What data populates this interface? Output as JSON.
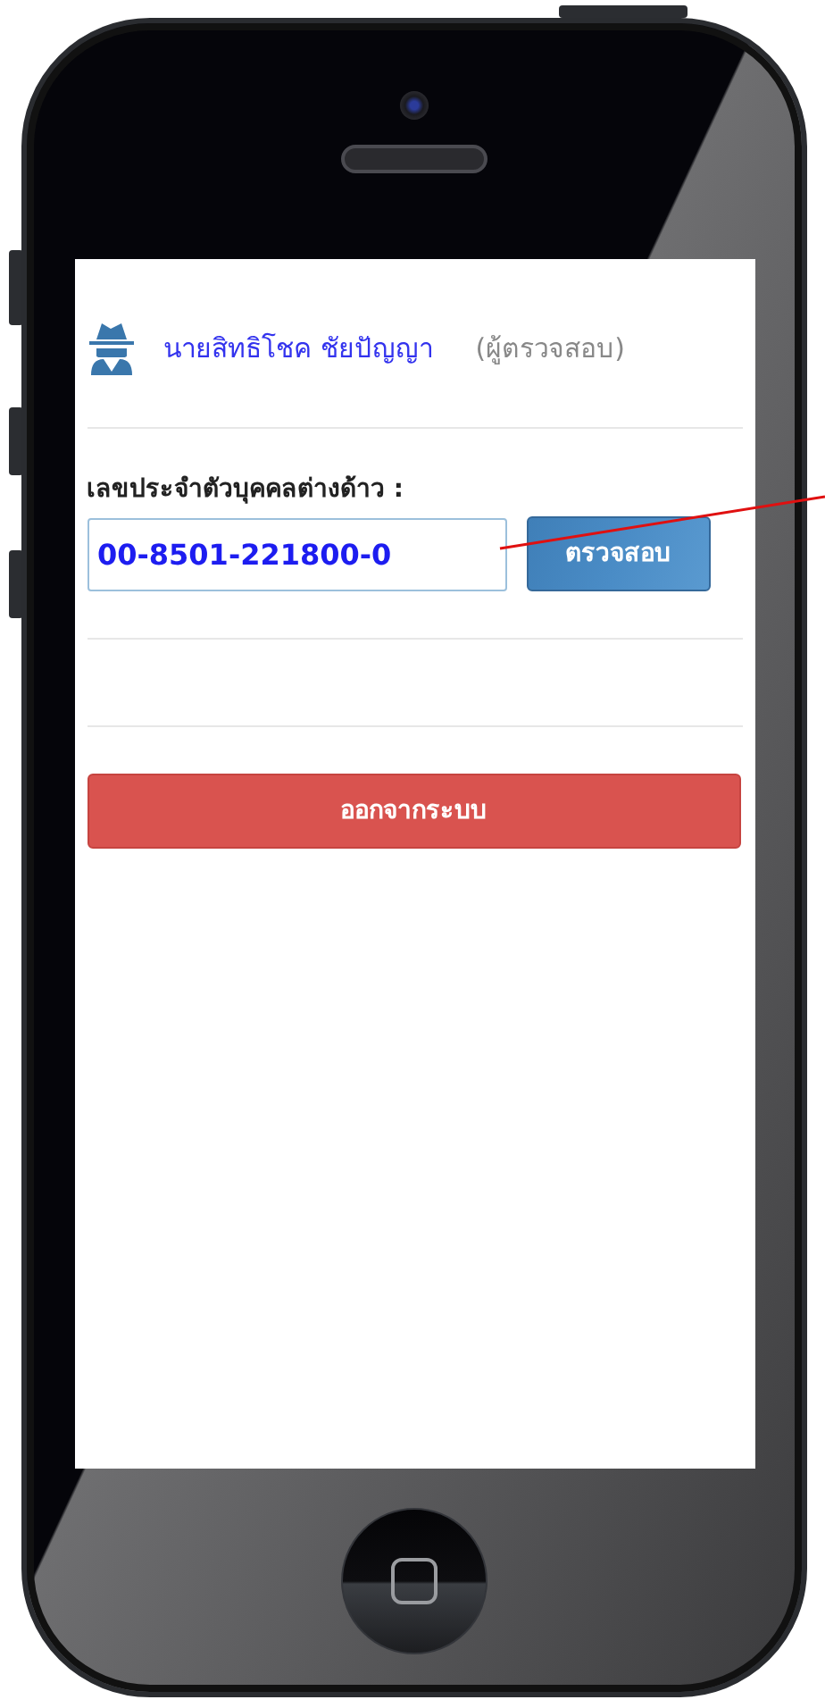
{
  "user": {
    "name": "นายสิทธิโชค ชัยปัญญา",
    "role": "(ผู้ตรวจสอบ)"
  },
  "id_form": {
    "label": "เลขประจำตัวบุคคลต่างด้าว :",
    "value": "00-8501-221800-0",
    "button": "ตรวจสอบ"
  },
  "logout_button": "ออกจากระบบ"
}
